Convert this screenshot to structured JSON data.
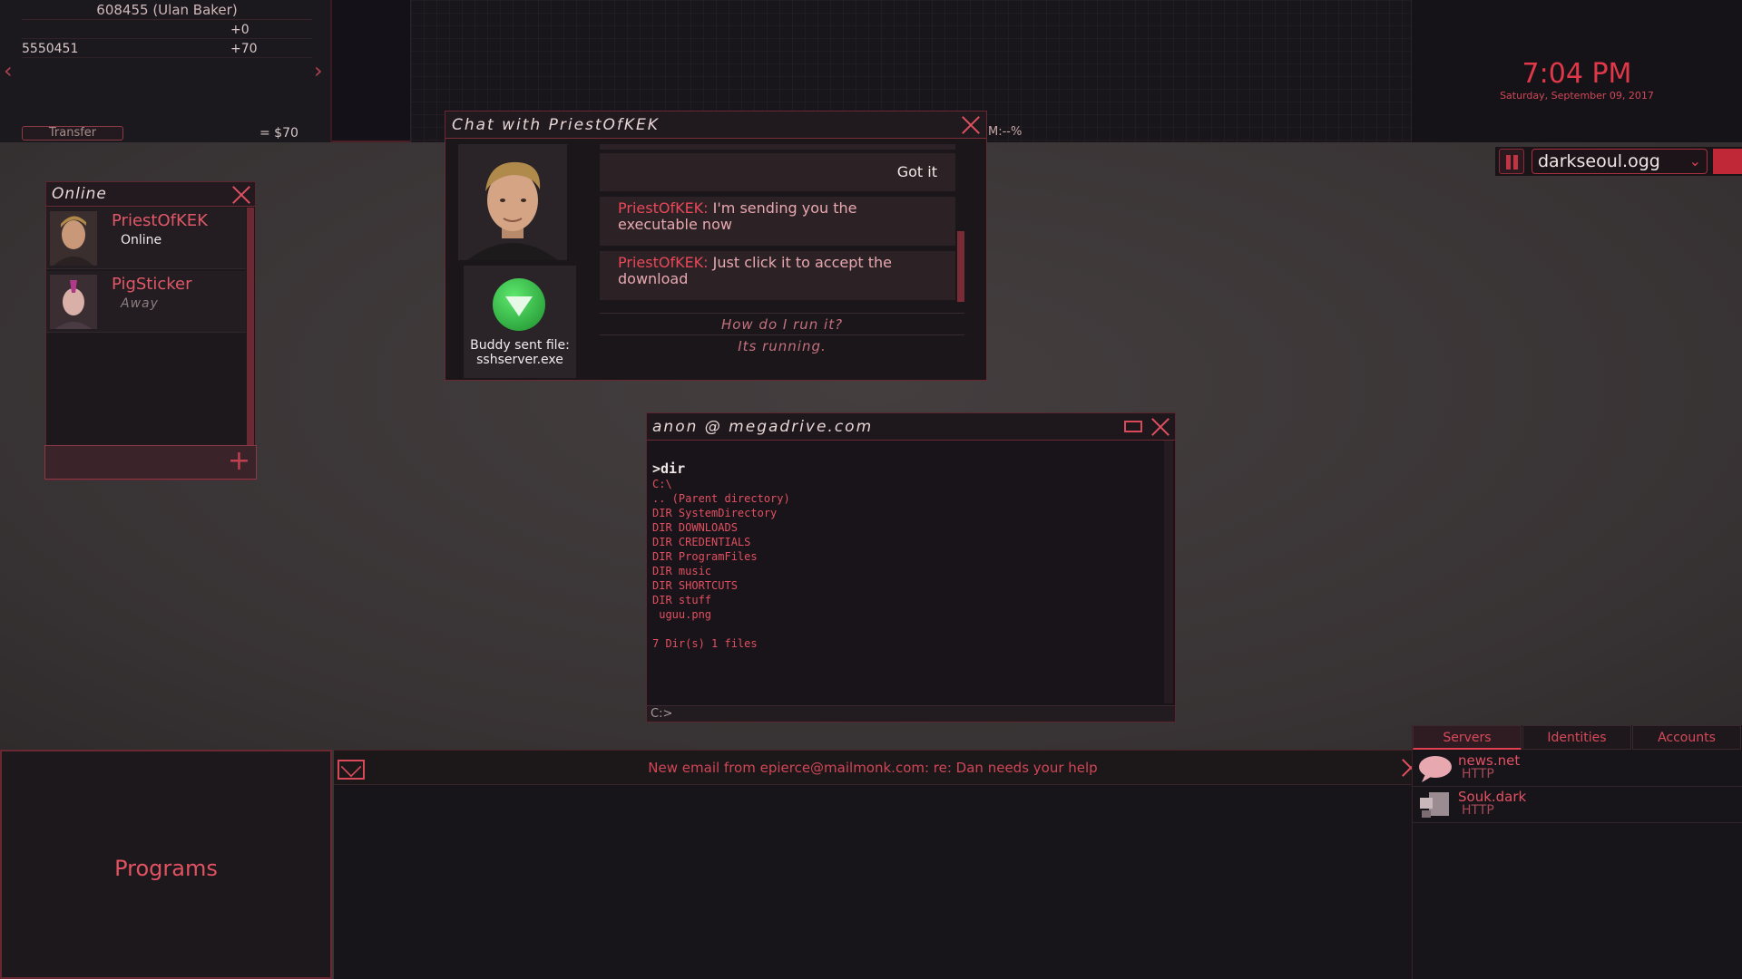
{
  "bank": {
    "account": "608455 (Ulan Baker)",
    "row1_right": "+0",
    "row2_left": "5550451",
    "row2_right": "+70",
    "transfer_label": "Transfer",
    "total": "= $70"
  },
  "graph": {
    "ram_label": "M:--%"
  },
  "clock": {
    "time": "7:04 PM",
    "date": "Saturday, September 09, 2017"
  },
  "music": {
    "track": "darkseoul.ogg"
  },
  "online": {
    "title": "Online",
    "buddies": [
      {
        "name": "PriestOfKEK",
        "status": "Online"
      },
      {
        "name": "PigSticker",
        "status": "Away"
      }
    ]
  },
  "chat": {
    "title": "Chat with PriestOfKEK",
    "file_caption_line1": "Buddy sent file:",
    "file_caption_line2": "sshserver.exe",
    "messages": [
      {
        "sender": "",
        "text": "Got it"
      },
      {
        "sender": "PriestOfKEK:",
        "text": "I'm sending you the executable now"
      },
      {
        "sender": "PriestOfKEK:",
        "text": "Just click it to accept the download"
      }
    ],
    "options": [
      "How do I run it?",
      "Its running."
    ]
  },
  "terminal": {
    "title": "anon @ megadrive.com",
    "command": ">dir",
    "lines": [
      "C:\\",
      ".. (Parent directory)",
      "DIR SystemDirectory",
      "DIR DOWNLOADS",
      "DIR CREDENTIALS",
      "DIR ProgramFiles",
      "DIR music",
      "DIR SHORTCUTS",
      "DIR stuff",
      " uguu.png",
      "",
      "7 Dir(s) 1 files"
    ],
    "prompt": "C:>"
  },
  "programs": {
    "label": "Programs"
  },
  "mail": {
    "notification": "New email from epierce@mailmonk.com: re: Dan needs your help"
  },
  "network": {
    "tabs": [
      "Servers",
      "Identities",
      "Accounts"
    ],
    "servers": [
      {
        "name": "news.net",
        "protocol": "HTTP",
        "icon": "speech-bubble-icon"
      },
      {
        "name": "Souk.dark",
        "protocol": "HTTP",
        "icon": "computer-icon"
      }
    ]
  },
  "colors": {
    "accent": "#e04050",
    "panel": "#1d181c",
    "desktop": "#3a3536"
  }
}
